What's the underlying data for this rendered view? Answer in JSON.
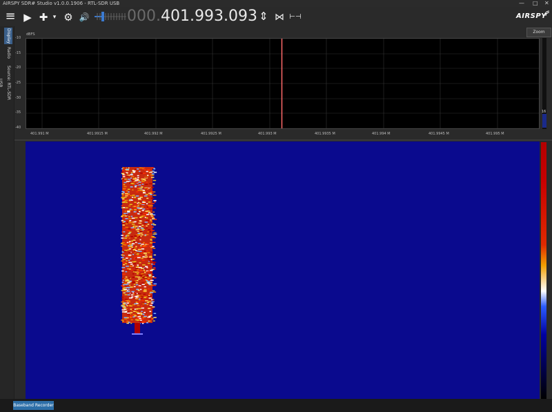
{
  "window": {
    "title": "AIRSPY SDR# Studio v1.0.0.1906 - RTL-SDR USB",
    "minimize": "—",
    "maximize": "□",
    "close": "✕"
  },
  "toolbar": {
    "menu_icon": "≡",
    "play_icon": "▶",
    "add_icon": "✚",
    "add_dropdown_icon": "▾",
    "settings_icon": "⚙",
    "volume_icon": "🔊",
    "frequency_prefix": "000.",
    "frequency": "401.993.093",
    "tune_arrows_icon": "⇕",
    "center_icon": "⋈",
    "span_icon": "⊢⊣"
  },
  "logo": "AIRSPY",
  "left_tabs": [
    {
      "label": "Display",
      "active": true
    },
    {
      "label": "Radio",
      "active": false
    },
    {
      "label": "Source: RTL-SDR USB",
      "active": false
    }
  ],
  "zoom_button": "Zoom",
  "spectrum": {
    "unit": "dBFS",
    "y_ticks": [
      "-10",
      "-15",
      "-20",
      "-25",
      "-30",
      "-35",
      "-40"
    ],
    "x_ticks": [
      "401.991 M",
      "401.9915 M",
      "401.992 M",
      "401.9925 M",
      "401.993 M",
      "401.9935 M",
      "401.994 M",
      "401.9945 M",
      "401.995 M"
    ],
    "marker_frequency_fraction": 0.498,
    "scroll_value": "16"
  },
  "colors": {
    "waterfall_bg": "#0a0a8e",
    "marker": "#ff6a6a",
    "accent": "#2d6fa8"
  },
  "status": {
    "baseband_recorder": "Baseband Recorder"
  }
}
